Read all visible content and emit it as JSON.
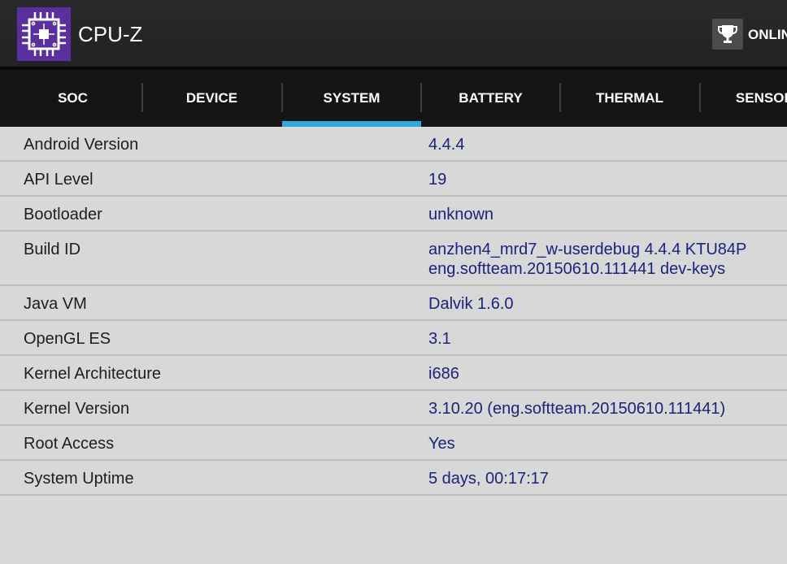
{
  "app": {
    "title": "CPU-Z",
    "icon": "chip-icon",
    "online_label": "ONLINE",
    "online_icon": "trophy-icon",
    "colors": {
      "actionbar": "#252525",
      "icon_bg": "#5a2f9e",
      "tab_indicator": "#2fa8dd",
      "value_text": "#1a237e"
    }
  },
  "tabs": [
    {
      "label": "SOC",
      "active": false
    },
    {
      "label": "DEVICE",
      "active": false
    },
    {
      "label": "SYSTEM",
      "active": true
    },
    {
      "label": "BATTERY",
      "active": false
    },
    {
      "label": "THERMAL",
      "active": false
    },
    {
      "label": "SENSORS",
      "active": false
    }
  ],
  "system": {
    "rows": [
      {
        "label": "Android Version",
        "value": [
          "4.4.4"
        ]
      },
      {
        "label": "API Level",
        "value": [
          "19"
        ]
      },
      {
        "label": "Bootloader",
        "value": [
          "unknown"
        ]
      },
      {
        "label": "Build ID",
        "value": [
          "anzhen4_mrd7_w-userdebug 4.4.4 KTU84P",
          "eng.softteam.20150610.111441 dev-keys"
        ]
      },
      {
        "label": "Java VM",
        "value": [
          "Dalvik 1.6.0"
        ]
      },
      {
        "label": "OpenGL ES",
        "value": [
          "3.1"
        ]
      },
      {
        "label": "Kernel Architecture",
        "value": [
          "i686"
        ]
      },
      {
        "label": "Kernel Version",
        "value": [
          "3.10.20 (eng.softteam.20150610.111441)"
        ]
      },
      {
        "label": "Root Access",
        "value": [
          "Yes"
        ]
      },
      {
        "label": "System Uptime",
        "value": [
          "5 days, 00:17:17"
        ]
      }
    ]
  }
}
